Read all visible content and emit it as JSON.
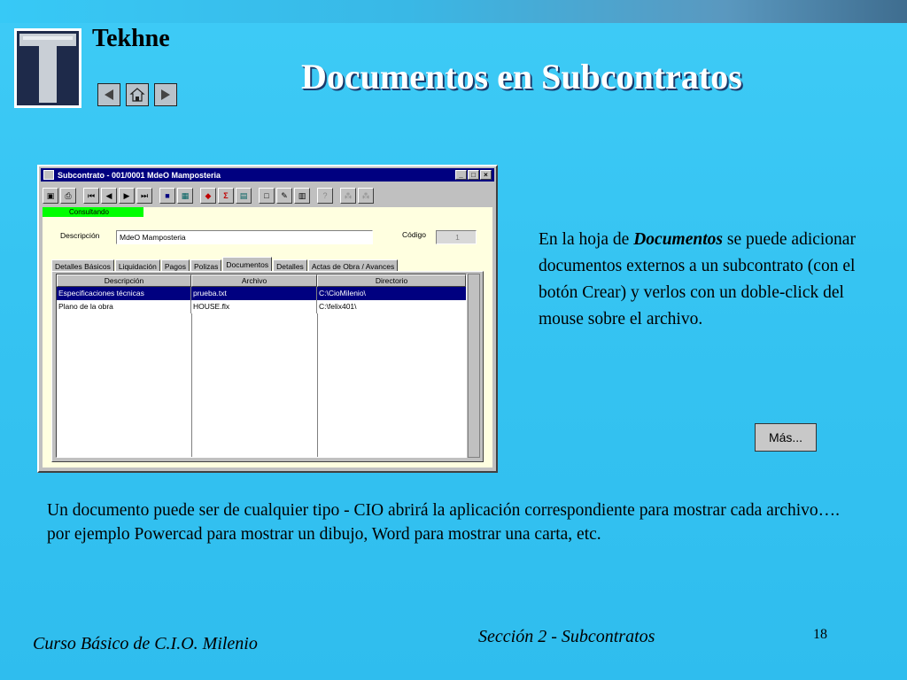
{
  "header": {
    "brand": "Tekhne",
    "title": "Documentos en Subcontratos",
    "nav": {
      "prev_icon": "left-triangle-icon",
      "home_icon": "home-icon",
      "next_icon": "right-triangle-icon"
    }
  },
  "window": {
    "title": "Subcontrato - 001/0001 MdeO Mamposteria",
    "controls": {
      "minimize": "_",
      "maximize": "□",
      "close": "×"
    },
    "status": "Consultando",
    "descripcion_label": "Descripción",
    "descripcion_value": "MdeO Mamposteria",
    "codigo_label": "Código",
    "codigo_value": "1",
    "tabs": [
      "Detalles Básicos",
      "Liquidación",
      "Pagos",
      "Polizas",
      "Documentos",
      "Detalles",
      "Actas de Obra / Avances"
    ],
    "active_tab": "Documentos",
    "grid": {
      "columns": [
        "Descripción",
        "Archivo",
        "Directorio"
      ],
      "rows": [
        [
          "Especificaciones técnicas",
          "prueba.txt",
          "C:\\CioMilenio\\"
        ],
        [
          "Plano de la obra",
          "HOUSE.flx",
          "C:\\felix401\\"
        ]
      ],
      "selected_row": 0
    },
    "toolbar_icons": [
      "open-icon",
      "print-icon",
      "first-record-icon",
      "prev-record-icon",
      "next-record-icon",
      "last-record-icon",
      "form-icon",
      "grid-icon",
      "sort-icon",
      "sum-icon",
      "calendar-icon",
      "new-icon",
      "edit-icon",
      "delete-icon",
      "help-icon",
      "lookup-icon",
      "lookup-all-icon"
    ]
  },
  "right_text": {
    "pre": "En la hoja de ",
    "emph": "Documentos",
    "post": " se puede adicionar documentos externos a un subcontrato (con el botón Crear) y verlos con un doble-click del mouse sobre el archivo."
  },
  "mas_button": "Más...",
  "bottom_text": "Un documento puede ser de cualquier tipo - CIO abrirá la aplicación correspondiente para mostrar cada archivo…. por ejemplo Powercad para mostrar un dibujo, Word para mostrar una carta, etc.",
  "footer": {
    "left": "Curso Básico de C.I.O. Milenio",
    "middle": "Sección 2 - Subcontratos",
    "page": "18"
  },
  "colors": {
    "background": "#36c4f2",
    "title_shadow": "#1b3a6b",
    "titlebar": "#000080",
    "status_green": "#00ff00",
    "content_bg": "#ffffe0"
  }
}
